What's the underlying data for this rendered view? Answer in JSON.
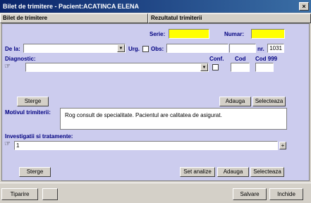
{
  "window": {
    "title": "Bilet de trimitere - Pacient:ACATINCA ELENA",
    "close_glyph": "×"
  },
  "tabs": [
    "Bilet de trimitere",
    "Rezultatul trimiterii"
  ],
  "form": {
    "serie_label": "Serie:",
    "serie_value": "",
    "numar_label": "Numar:",
    "numar_value": "",
    "de_la_label": "De la:",
    "de_la_value": "",
    "urg_label": "Urg.",
    "obs_label": "Obs:",
    "obs_value": "",
    "nr_label": "nr.",
    "nr_value": "1031",
    "diagnostic_label": "Diagnostic:",
    "diagnostic_value": "",
    "conf_label": "Conf.",
    "cod_label": "Cod",
    "cod999_label": "Cod 999",
    "sterge_label": "Sterge",
    "adauga_label": "Adauga",
    "selecteaza_label": "Selecteaza",
    "motiv_label": "Motivul trimiterii:",
    "motiv_text": "Rog consult de specialitate. Pacientul are calitatea de asigurat.",
    "investigatii_label": "Investigatii si tratamente:",
    "investigatii_value": "1",
    "plus_glyph": "+",
    "sterge2_label": "Sterge",
    "set_analize_label": "Set analize",
    "adauga2_label": "Adauga",
    "selecteaza2_label": "Selecteaza"
  },
  "bottom": {
    "tiparire_label": "Tiparire",
    "salvare_label": "Salvare",
    "inchide_label": "Inchide"
  }
}
